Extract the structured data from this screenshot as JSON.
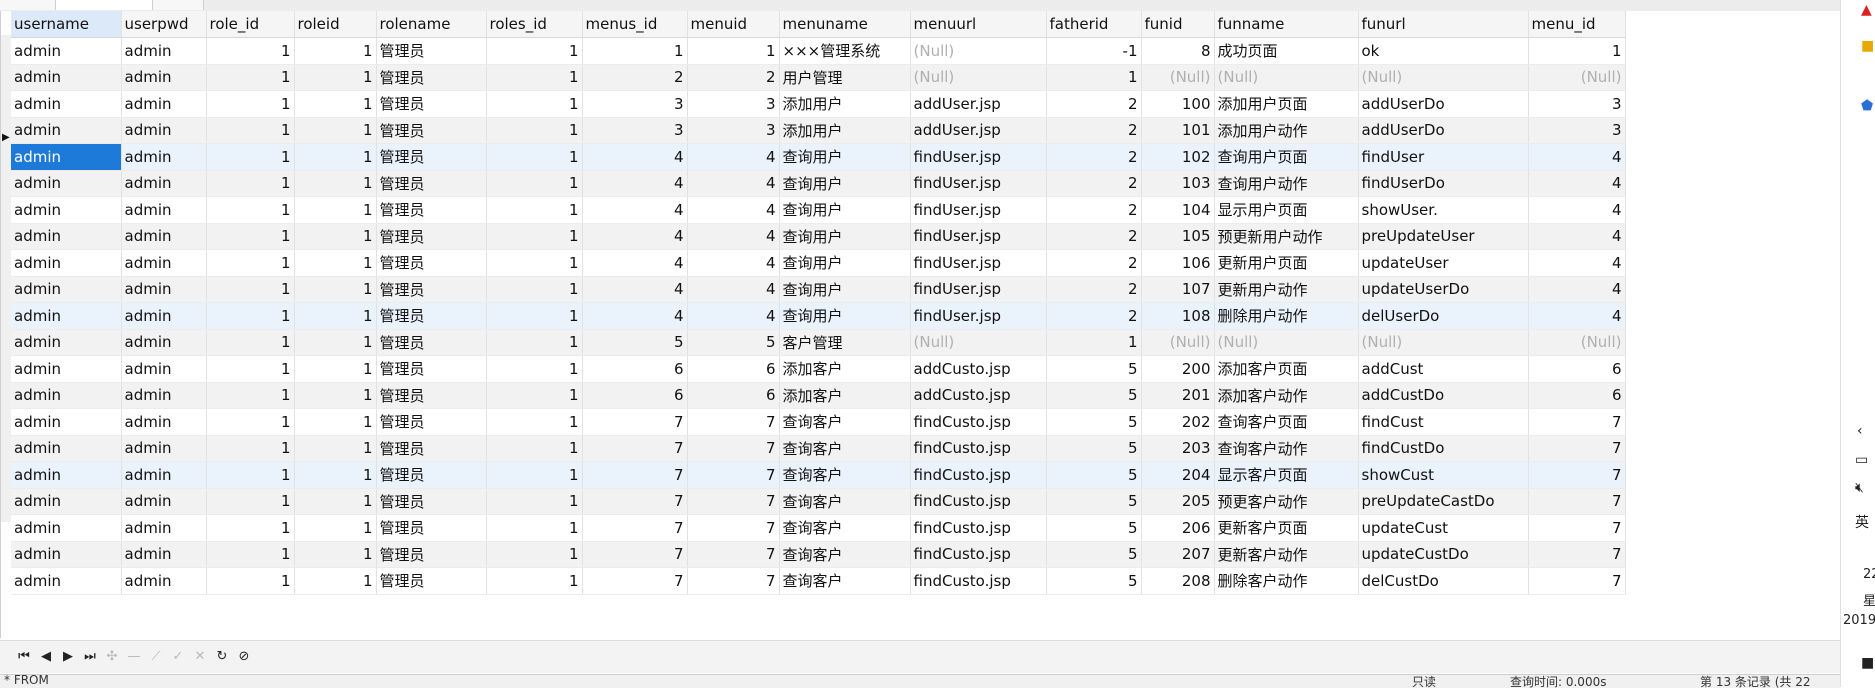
{
  "columns": [
    "username",
    "userpwd",
    "role_id",
    "roleid",
    "rolename",
    "roles_id",
    "menus_id",
    "menuid",
    "menuname",
    "menuurl",
    "fatherid",
    "funid",
    "funname",
    "funurl",
    "menu_id"
  ],
  "numeric_columns": [
    2,
    3,
    5,
    6,
    7,
    10,
    11,
    14
  ],
  "null_label": "(Null)",
  "rows": [
    [
      "admin",
      "admin",
      "1",
      "1",
      "管理员",
      "1",
      "1",
      "1",
      "×××管理系统",
      "(Null)",
      "-1",
      "8",
      "成功页面",
      "ok",
      "1"
    ],
    [
      "admin",
      "admin",
      "1",
      "1",
      "管理员",
      "1",
      "2",
      "2",
      "用户管理",
      "(Null)",
      "1",
      "(Null)",
      "(Null)",
      "(Null)",
      "(Null)"
    ],
    [
      "admin",
      "admin",
      "1",
      "1",
      "管理员",
      "1",
      "3",
      "3",
      "添加用户",
      "addUser.jsp",
      "2",
      "100",
      "添加用户页面",
      "addUserDo",
      "3"
    ],
    [
      "admin",
      "admin",
      "1",
      "1",
      "管理员",
      "1",
      "3",
      "3",
      "添加用户",
      "addUser.jsp",
      "2",
      "101",
      "添加用户动作",
      "addUserDo",
      "3"
    ],
    [
      "admin",
      "admin",
      "1",
      "1",
      "管理员",
      "1",
      "4",
      "4",
      "查询用户",
      "findUser.jsp",
      "2",
      "102",
      "查询用户页面",
      "findUser",
      "4"
    ],
    [
      "admin",
      "admin",
      "1",
      "1",
      "管理员",
      "1",
      "4",
      "4",
      "查询用户",
      "findUser.jsp",
      "2",
      "103",
      "查询用户动作",
      "findUserDo",
      "4"
    ],
    [
      "admin",
      "admin",
      "1",
      "1",
      "管理员",
      "1",
      "4",
      "4",
      "查询用户",
      "findUser.jsp",
      "2",
      "104",
      "显示用户页面",
      "showUser.",
      "4"
    ],
    [
      "admin",
      "admin",
      "1",
      "1",
      "管理员",
      "1",
      "4",
      "4",
      "查询用户",
      "findUser.jsp",
      "2",
      "105",
      "预更新用户动作",
      "preUpdateUser",
      "4"
    ],
    [
      "admin",
      "admin",
      "1",
      "1",
      "管理员",
      "1",
      "4",
      "4",
      "查询用户",
      "findUser.jsp",
      "2",
      "106",
      "更新用户页面",
      "updateUser",
      "4"
    ],
    [
      "admin",
      "admin",
      "1",
      "1",
      "管理员",
      "1",
      "4",
      "4",
      "查询用户",
      "findUser.jsp",
      "2",
      "107",
      "更新用户动作",
      "updateUserDo",
      "4"
    ],
    [
      "admin",
      "admin",
      "1",
      "1",
      "管理员",
      "1",
      "4",
      "4",
      "查询用户",
      "findUser.jsp",
      "2",
      "108",
      "删除用户动作",
      "delUserDo",
      "4"
    ],
    [
      "admin",
      "admin",
      "1",
      "1",
      "管理员",
      "1",
      "5",
      "5",
      "客户管理",
      "(Null)",
      "1",
      "(Null)",
      "(Null)",
      "(Null)",
      "(Null)"
    ],
    [
      "admin",
      "admin",
      "1",
      "1",
      "管理员",
      "1",
      "6",
      "6",
      "添加客户",
      "addCusto.jsp",
      "5",
      "200",
      "添加客户页面",
      "addCust",
      "6"
    ],
    [
      "admin",
      "admin",
      "1",
      "1",
      "管理员",
      "1",
      "6",
      "6",
      "添加客户",
      "addCusto.jsp",
      "5",
      "201",
      "添加客户动作",
      "addCustDo",
      "6"
    ],
    [
      "admin",
      "admin",
      "1",
      "1",
      "管理员",
      "1",
      "7",
      "7",
      "查询客户",
      "findCusto.jsp",
      "5",
      "202",
      "查询客户页面",
      "findCust",
      "7"
    ],
    [
      "admin",
      "admin",
      "1",
      "1",
      "管理员",
      "1",
      "7",
      "7",
      "查询客户",
      "findCusto.jsp",
      "5",
      "203",
      "查询客户动作",
      "findCustDo",
      "7"
    ],
    [
      "admin",
      "admin",
      "1",
      "1",
      "管理员",
      "1",
      "7",
      "7",
      "查询客户",
      "findCusto.jsp",
      "5",
      "204",
      "显示客户页面",
      "showCust",
      "7"
    ],
    [
      "admin",
      "admin",
      "1",
      "1",
      "管理员",
      "1",
      "7",
      "7",
      "查询客户",
      "findCusto.jsp",
      "5",
      "205",
      "预更客户动作",
      "preUpdateCastDo",
      "7"
    ],
    [
      "admin",
      "admin",
      "1",
      "1",
      "管理员",
      "1",
      "7",
      "7",
      "查询客户",
      "findCusto.jsp",
      "5",
      "206",
      "更新客户页面",
      "updateCust",
      "7"
    ],
    [
      "admin",
      "admin",
      "1",
      "1",
      "管理员",
      "1",
      "7",
      "7",
      "查询客户",
      "findCusto.jsp",
      "5",
      "207",
      "更新客户动作",
      "updateCustDo",
      "7"
    ],
    [
      "admin",
      "admin",
      "1",
      "1",
      "管理员",
      "1",
      "7",
      "7",
      "查询客户",
      "findCusto.jsp",
      "5",
      "208",
      "删除客户动作",
      "delCustDo",
      "7"
    ]
  ],
  "selected_row": 4,
  "navigator": {
    "buttons": [
      {
        "name": "first-record-icon",
        "glyph": "⏮",
        "enabled": true
      },
      {
        "name": "prev-record-icon",
        "glyph": "◀",
        "enabled": true
      },
      {
        "name": "next-record-icon",
        "glyph": "▶",
        "enabled": true
      },
      {
        "name": "last-record-icon",
        "glyph": "⏭",
        "enabled": true
      },
      {
        "name": "add-record-icon",
        "glyph": "✣",
        "enabled": false
      },
      {
        "name": "delete-record-icon",
        "glyph": "—",
        "enabled": false
      },
      {
        "name": "edit-record-icon",
        "glyph": "⟋",
        "enabled": false
      },
      {
        "name": "apply-icon",
        "glyph": "✓",
        "enabled": false
      },
      {
        "name": "cancel-icon",
        "glyph": "✕",
        "enabled": false
      },
      {
        "name": "refresh-icon",
        "glyph": "↻",
        "enabled": true
      },
      {
        "name": "stop-icon",
        "glyph": "⊘",
        "enabled": true
      }
    ]
  },
  "statusbar": {
    "left": "* FROM",
    "mid1": "只读",
    "mid2": "查询时间: 0.000s",
    "right": "第 13 条记录 (共 22"
  },
  "tray": {
    "clock_line1": "22",
    "clock_line2": "星",
    "clock_line3": "2019"
  }
}
